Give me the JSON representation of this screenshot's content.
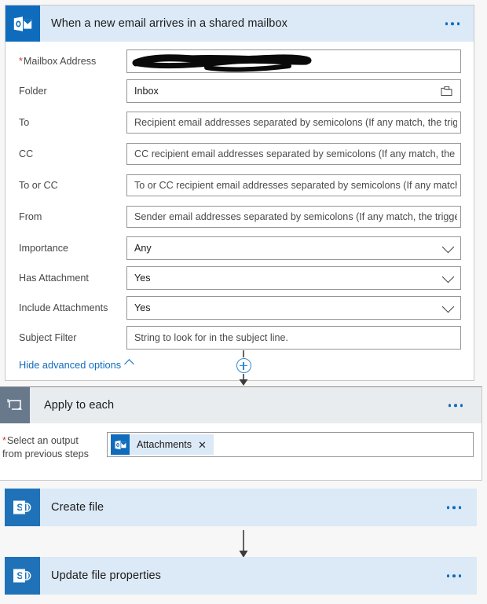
{
  "flow": {
    "trigger": {
      "icon": "outlook-icon",
      "title": "When a new email arrives in a shared mailbox",
      "menu_icon": "ellipsis-icon",
      "fields": [
        {
          "label": "Mailbox Address",
          "required": true,
          "type": "redacted",
          "value": "",
          "placeholder": ""
        },
        {
          "label": "Folder",
          "required": false,
          "type": "picker",
          "value": "Inbox",
          "placeholder": "",
          "icon": "folder-icon"
        },
        {
          "label": "To",
          "required": false,
          "type": "text",
          "value": "",
          "placeholder": "Recipient email addresses separated by semicolons (If any match, the trigger ..."
        },
        {
          "label": "CC",
          "required": false,
          "type": "text",
          "value": "",
          "placeholder": "CC recipient email addresses separated by semicolons (If any match, the trigg..."
        },
        {
          "label": "To or CC",
          "required": false,
          "type": "text",
          "value": "",
          "placeholder": "To or CC recipient email addresses separated by semicolons (If any match, th..."
        },
        {
          "label": "From",
          "required": false,
          "type": "text",
          "value": "",
          "placeholder": "Sender email addresses separated by semicolons (If any match, the trigger wi..."
        },
        {
          "label": "Importance",
          "required": false,
          "type": "dropdown",
          "value": "Any",
          "placeholder": ""
        },
        {
          "label": "Has Attachment",
          "required": false,
          "type": "dropdown",
          "value": "Yes",
          "placeholder": ""
        },
        {
          "label": "Include Attachments",
          "required": false,
          "type": "dropdown",
          "value": "Yes",
          "placeholder": ""
        },
        {
          "label": "Subject Filter",
          "required": false,
          "type": "text",
          "value": "",
          "placeholder": "String to look for in the subject line."
        }
      ],
      "advanced_options_link": "Hide advanced options",
      "advanced_caret": "chevron-up-icon"
    },
    "connector_add": {
      "icon": "add-step-icon",
      "label": "+"
    },
    "loop": {
      "icon": "loop-icon",
      "title": "Apply to each",
      "menu_icon": "ellipsis-icon",
      "output_label_line1": "Select an output",
      "output_label_line2": "from previous steps",
      "output_required": true,
      "token": {
        "icon": "outlook-icon",
        "label": "Attachments",
        "remove_icon": "close-icon"
      }
    },
    "actions": [
      {
        "icon": "sharepoint-icon",
        "title": "Create file",
        "menu_icon": "ellipsis-icon"
      },
      {
        "icon": "sharepoint-icon",
        "title": "Update file properties",
        "menu_icon": "ellipsis-icon"
      }
    ]
  },
  "colors": {
    "outlook_blue": "#0f6cbd",
    "sharepoint_blue": "#1f72b8",
    "loop_gray": "#69798c",
    "header_blue": "#dce9f6",
    "header_gray": "#e8ecee",
    "link_blue": "#0f6cbd",
    "required_red": "#d13438",
    "arrow_gray": "#3b3b3b"
  }
}
